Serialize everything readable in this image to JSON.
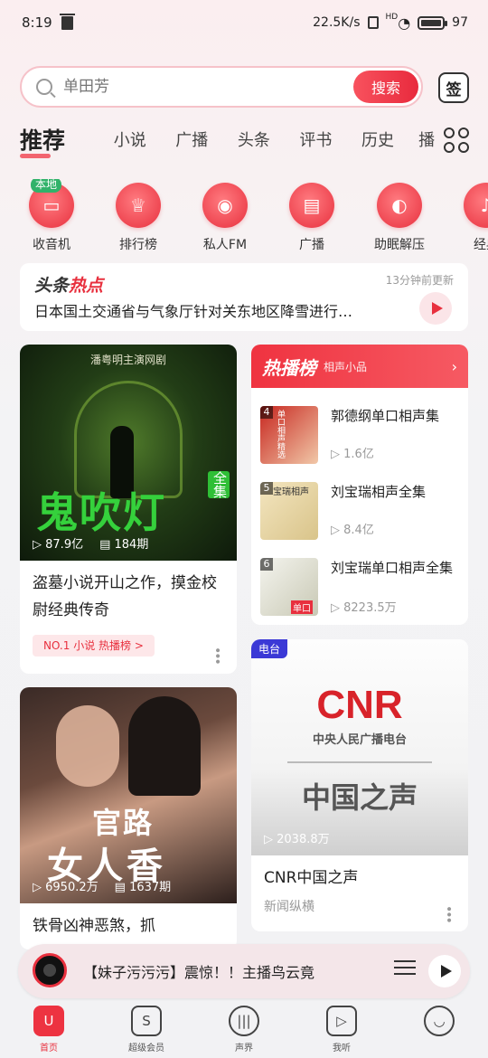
{
  "status_bar": {
    "time": "8:19",
    "net_speed": "22.5K/s",
    "wifi_badge": "HD",
    "battery": "97",
    "battery_level": 0.97
  },
  "search": {
    "placeholder": "单田芳",
    "button": "搜索",
    "sign": "签"
  },
  "tabs": [
    "推荐",
    "小说",
    "广播",
    "头条",
    "评书",
    "历史",
    "播"
  ],
  "icons": [
    {
      "label": "收音机",
      "badge": "本地",
      "icon": "radio-icon"
    },
    {
      "label": "排行榜",
      "icon": "trophy-icon"
    },
    {
      "label": "私人FM",
      "icon": "fm-icon"
    },
    {
      "label": "广播",
      "icon": "broadcast-icon"
    },
    {
      "label": "助眠解压",
      "icon": "moon-icon"
    },
    {
      "label": "经典",
      "icon": "classic-icon"
    }
  ],
  "headline": {
    "brand_a": "头条",
    "brand_b": "热点",
    "update": "13分钟前更新",
    "text": "日本国土交通省与气象厅针对关东地区降雪进行…"
  },
  "card1": {
    "cover_top": "潘粤明主演网剧",
    "cover_title": "鬼吹灯",
    "cover_tag": "全集",
    "plays": "87.9亿",
    "episodes": "184期",
    "title": "盗墓小说开山之作，摸金校尉经典传奇",
    "badge": "NO.1 小说 热播榜 >"
  },
  "hot_chart": {
    "title": "热播榜",
    "subtitle": "相声小品",
    "items": [
      {
        "num": "4",
        "name": "郭德纲单口相声集",
        "count": "1.6亿"
      },
      {
        "num": "5",
        "name": "刘宝瑞相声全集",
        "count": "8.4亿"
      },
      {
        "num": "6",
        "name": "刘宝瑞单口相声全集",
        "count": "8223.5万"
      }
    ],
    "thumb_texts": [
      "单口相声精选",
      "宝瑞相声",
      "单口"
    ]
  },
  "card2": {
    "tag": "电台",
    "logo": "CNR",
    "logo_sub": "中央人民广播电台",
    "voice": "中国之声",
    "plays": "2038.8万",
    "title": "CNR中国之声",
    "category": "新闻纵横"
  },
  "card3": {
    "cover_title_a": "官路",
    "cover_title_b": "女人香",
    "plays": "6950.2万",
    "episodes": "1637期",
    "title": "铁骨凶神恶煞，抓"
  },
  "player": {
    "text": "【妹子污污污】震惊！！主播鸟云竟"
  },
  "nav": [
    {
      "label": "首页",
      "icon": "home-icon",
      "glyph": "U"
    },
    {
      "label": "超级会员",
      "icon": "vip-icon",
      "glyph": "S"
    },
    {
      "label": "声界",
      "icon": "sound-icon",
      "glyph": "|||"
    },
    {
      "label": "我听",
      "icon": "listen-icon",
      "glyph": "▷"
    },
    {
      "label": "",
      "icon": "profile-icon",
      "glyph": "◡"
    }
  ],
  "colors": {
    "accent": "#e8303e",
    "bg": "#f2f2f4"
  }
}
